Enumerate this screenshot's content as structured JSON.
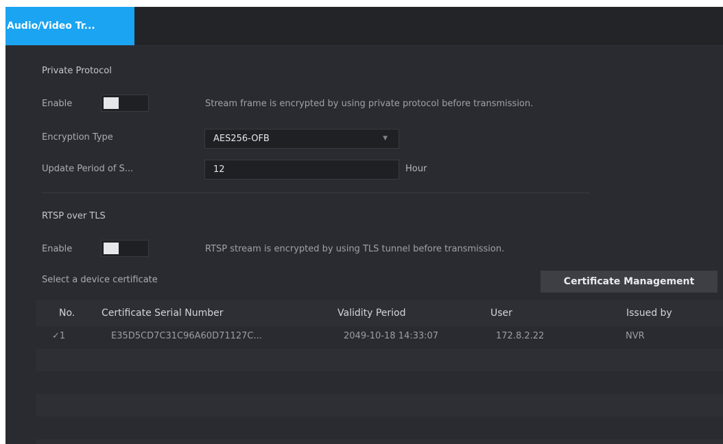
{
  "tab": {
    "label": "Audio/Video Tr..."
  },
  "private_protocol": {
    "section_title": "Private Protocol",
    "enable_label": "Enable",
    "enabled": false,
    "description": "Stream frame is encrypted by using private protocol before transmission.",
    "encryption_label": "Encryption Type",
    "encryption_value": "AES256-OFB",
    "update_label": "Update Period of S...",
    "update_value": "12",
    "update_unit": "Hour"
  },
  "rtsp": {
    "section_title": "RTSP over TLS",
    "enable_label": "Enable",
    "enabled": false,
    "description": "RTSP stream is encrypted by using TLS tunnel before transmission.",
    "select_label": "Select a device certificate",
    "cert_button": "Certificate Management"
  },
  "table": {
    "headers": {
      "no": "No.",
      "serial": "Certificate Serial Number",
      "validity": "Validity Period",
      "user": "User",
      "issued": "Issued by"
    },
    "rows": [
      {
        "no": "✓1",
        "serial": "E35D5CD7C31C96A60D71127C...",
        "validity": "2049-10-18 14:33:07",
        "user": "172.8.2.22",
        "issued": "NVR"
      }
    ]
  }
}
